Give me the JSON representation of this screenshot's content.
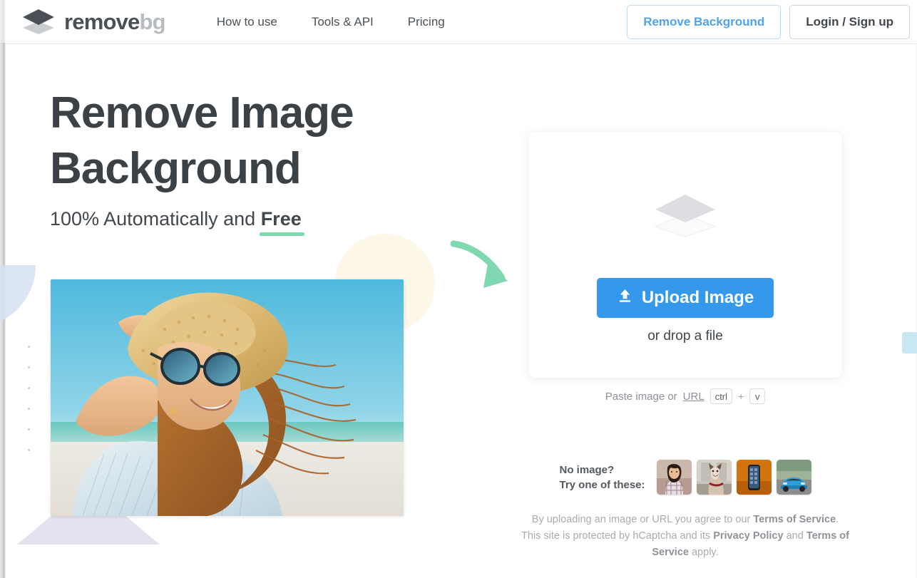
{
  "header": {
    "brand": {
      "name_primary": "remove",
      "name_secondary": "bg",
      "logo_icon": "layers-icon"
    },
    "nav": [
      {
        "label": "How to use",
        "name": "nav-how-to-use"
      },
      {
        "label": "Tools & API",
        "name": "nav-tools-api"
      },
      {
        "label": "Pricing",
        "name": "nav-pricing"
      }
    ],
    "actions": {
      "remove_background": "Remove Background",
      "login_signup": "Login / Sign up"
    },
    "accent_color": "#4ea3ef"
  },
  "hero": {
    "title_line1": "Remove Image",
    "title_line2": "Background",
    "subtitle_prefix": "100% Automatically and ",
    "subtitle_highlight": "Free",
    "highlight_color": "#7fd8b0",
    "photo_alt": "woman in straw hat and sunglasses at the beach"
  },
  "arrow": {
    "name": "curved-arrow-icon",
    "color": "#7fd8b0"
  },
  "upload": {
    "layers_icon": "layers-icon",
    "button_label": "Upload Image",
    "button_icon": "upload-icon",
    "button_color": "#3498ed",
    "drop_text": "or drop a file",
    "paste_text": "Paste image or",
    "paste_link": "URL",
    "shortcut_key1": "ctrl",
    "shortcut_plus": "+",
    "shortcut_key2": "v"
  },
  "samples": {
    "label_line1": "No image?",
    "label_line2": "Try one of these:",
    "thumbnails": [
      {
        "name": "sample-thumbnail-woman",
        "alt": "woman in plaid shirt"
      },
      {
        "name": "sample-thumbnail-cat",
        "alt": "siamese cat"
      },
      {
        "name": "sample-thumbnail-phone",
        "alt": "smartphone on orange background"
      },
      {
        "name": "sample-thumbnail-car",
        "alt": "blue sports car"
      }
    ]
  },
  "legal": {
    "part1": "By uploading an image or URL you agree to our ",
    "terms1": "Terms of Service",
    "part2": ". This site is protected by hCaptcha and its ",
    "privacy": "Privacy Policy",
    "part3": " and ",
    "terms2": "Terms of Service",
    "part4": " apply."
  },
  "side_tab": {
    "name": "feedback-tab",
    "color": "#c9e7f3"
  }
}
